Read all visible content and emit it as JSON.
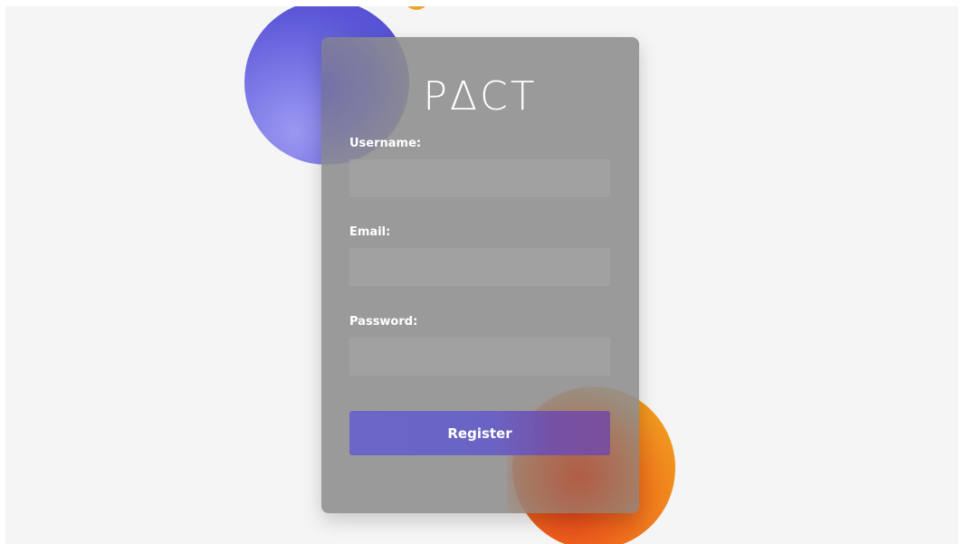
{
  "logo": {
    "text": "PΔCT"
  },
  "form": {
    "username": {
      "label": "Username:",
      "value": "",
      "placeholder": ""
    },
    "email": {
      "label": "Email:",
      "value": "",
      "placeholder": ""
    },
    "password": {
      "label": "Password:",
      "value": "",
      "placeholder": ""
    },
    "register_button": "Register"
  },
  "colors": {
    "background": "#f5f5f5",
    "card": "#8c8c8c",
    "blue_circle": "#5a56d6",
    "orange_circle": "#f0961e",
    "button": "#6b66c8"
  }
}
